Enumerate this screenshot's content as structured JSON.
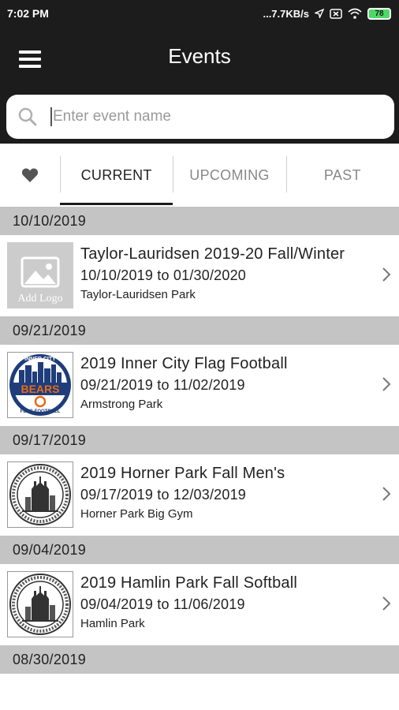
{
  "status_bar": {
    "time": "7:02 PM",
    "network_speed": "...7.7KB/s",
    "battery_level": "78",
    "icons": [
      "location-arrow-icon",
      "sim-card-icon",
      "wifi-icon",
      "battery-icon"
    ]
  },
  "app_bar": {
    "title": "Events",
    "menu_icon": "hamburger-menu-icon"
  },
  "search": {
    "placeholder": "Enter event name",
    "value": "",
    "icon": "search-icon"
  },
  "tabs": {
    "favorites_icon": "heart-icon",
    "items": [
      {
        "label": "CURRENT",
        "active": true
      },
      {
        "label": "UPCOMING",
        "active": false
      },
      {
        "label": "PAST",
        "active": false
      }
    ]
  },
  "groups": [
    {
      "date": "10/10/2019",
      "events": [
        {
          "name": "Taylor-Lauridsen 2019-20 Fall/Winter",
          "dates": "10/10/2019 to 01/30/2020",
          "location": "Taylor-Lauridsen Park",
          "logo": "placeholder",
          "logo_text": "Add Logo"
        }
      ]
    },
    {
      "date": "09/21/2019",
      "events": [
        {
          "name": "2019 Inner City Flag Football",
          "dates": "09/21/2019 to 11/02/2019",
          "location": "Armstrong Park",
          "logo": "bears",
          "logo_top": "INNER CITY",
          "logo_mid": "BEARS",
          "logo_bottom": "FLAG FOOTBALL"
        }
      ]
    },
    {
      "date": "09/17/2019",
      "events": [
        {
          "name": "2019 Horner Park Fall Men's",
          "dates": "09/17/2019 to 12/03/2019",
          "location": "Horner Park Big Gym",
          "logo": "park-district-seal"
        }
      ]
    },
    {
      "date": "09/04/2019",
      "events": [
        {
          "name": "2019 Hamlin Park Fall Softball",
          "dates": "09/04/2019 to 11/06/2019",
          "location": "Hamlin Park",
          "logo": "park-district-seal"
        }
      ]
    },
    {
      "date": "08/30/2019",
      "events": []
    }
  ],
  "colors": {
    "app_bar": "#1c1c1c",
    "date_header": "#c4c4c4",
    "battery": "#4cd964",
    "bears_blue": "#1f3d7a",
    "bears_orange": "#e86a1a"
  }
}
